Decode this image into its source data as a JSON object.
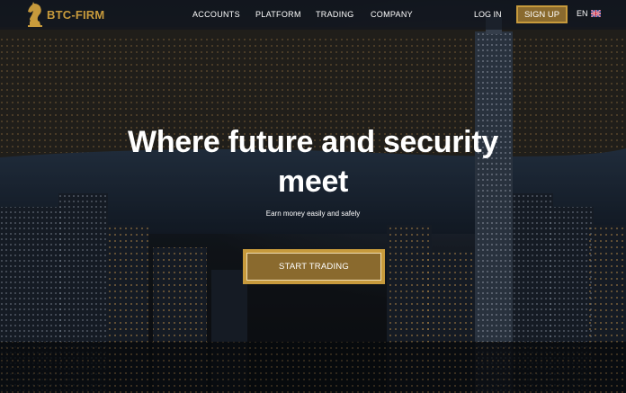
{
  "brand": {
    "name": "BTC-FIRM",
    "logo_icon": "chess-knight-icon",
    "accent": "#c79a3c"
  },
  "nav": {
    "items": [
      {
        "label": "ACCOUNTS"
      },
      {
        "label": "PLATFORM"
      },
      {
        "label": "TRADING"
      },
      {
        "label": "COMPANY"
      }
    ]
  },
  "header": {
    "login_label": "LOG IN",
    "signup_label": "SIGN UP",
    "lang_label": "EN",
    "lang_flag_icon": "uk-flag-icon"
  },
  "hero": {
    "headline_line1": "Where future and security",
    "headline_line2": "meet",
    "subtitle": "Earn money easily and safely",
    "cta_label": "START TRADING",
    "background_icon": "city-skyline-night-image"
  }
}
